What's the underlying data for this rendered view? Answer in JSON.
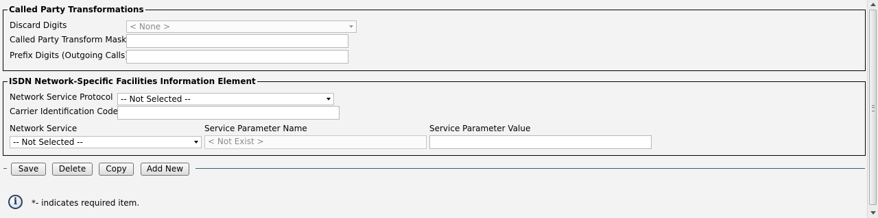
{
  "called_party": {
    "legend": "Called Party Transformations",
    "discard_digits": {
      "label": "Discard Digits",
      "value": "< None >"
    },
    "transform_mask": {
      "label": "Called Party Transform Mask",
      "value": ""
    },
    "prefix_digits": {
      "label": "Prefix Digits (Outgoing Calls)",
      "value": ""
    }
  },
  "isdn": {
    "legend": "ISDN Network-Specific Facilities Information Element",
    "network_service_protocol": {
      "label": "Network Service Protocol",
      "value": "-- Not Selected --"
    },
    "carrier_id_code": {
      "label": "Carrier Identification Code",
      "value": ""
    },
    "network_service": {
      "label": "Network Service",
      "value": "-- Not Selected --"
    },
    "service_param_name": {
      "label": "Service Parameter Name",
      "value": "< Not Exist >"
    },
    "service_param_value": {
      "label": "Service Parameter Value",
      "value": ""
    }
  },
  "actions": {
    "save": "Save",
    "delete": "Delete",
    "copy": "Copy",
    "add_new": "Add New"
  },
  "footer": {
    "required_note": "*- indicates required item.",
    "info_icon_glyph": "i"
  },
  "icons": {
    "info": "info-icon",
    "dropdown": "chevron-down-icon",
    "scroll_up": "scroll-up-arrow-icon",
    "scroll_down": "scroll-down-arrow-icon"
  }
}
